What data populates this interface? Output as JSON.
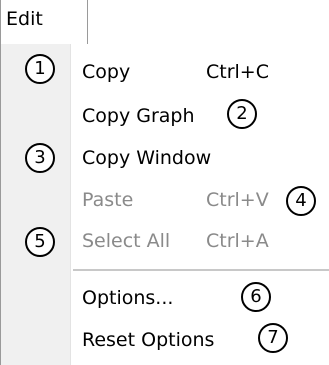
{
  "menubar": {
    "edit_label": "Edit"
  },
  "menu": {
    "items": [
      {
        "label": "Copy",
        "shortcut": "Ctrl+C",
        "enabled": true
      },
      {
        "label": "Copy Graph",
        "shortcut": "",
        "enabled": true
      },
      {
        "label": "Copy Window",
        "shortcut": "",
        "enabled": true
      },
      {
        "label": "Paste",
        "shortcut": "Ctrl+V",
        "enabled": false
      },
      {
        "label": "Select All",
        "shortcut": "Ctrl+A",
        "enabled": false
      },
      {
        "label": "Options...",
        "shortcut": "",
        "enabled": true
      },
      {
        "label": "Reset Options",
        "shortcut": "",
        "enabled": true
      }
    ]
  },
  "callouts": [
    "1",
    "2",
    "3",
    "4",
    "5",
    "6",
    "7"
  ],
  "colors": {
    "disabled_text": "#8a8a8a",
    "gutter": "#f0f0f0",
    "separator": "#c8c8c8"
  }
}
